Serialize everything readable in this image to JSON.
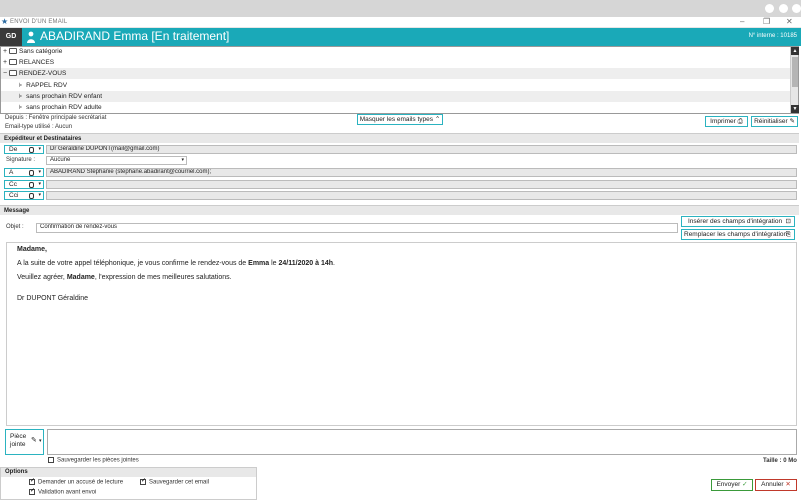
{
  "window": {
    "title": "ENVOI D'UN EMAIL"
  },
  "header": {
    "badge": "GD",
    "patient": "ABADIRAND Emma  [En traitement]",
    "internal_id": "N° interne : 10185"
  },
  "tree": {
    "items": [
      {
        "label": "Sans catégorie",
        "glyph": "+"
      },
      {
        "label": "RELANCES",
        "glyph": "+"
      },
      {
        "label": "RENDEZ-VOUS",
        "glyph": "−"
      },
      {
        "label": "RAPPEL RDV"
      },
      {
        "label": "sans prochain RDV enfant"
      },
      {
        "label": "sans prochain RDV adulte"
      }
    ]
  },
  "info": {
    "depuis": "Depuis : Fenêtre principale secrétariat",
    "email_type": "Email-type utilisé : Aucun"
  },
  "buttons": {
    "hide_types": "Masquer les emails types",
    "print": "Imprimer",
    "reset": "Réinitialiser",
    "insert_fields": "Insérer des champs d'intégration",
    "replace_fields": "Remplacer les champs d'intégration",
    "send": "Envoyer",
    "cancel": "Annuler"
  },
  "sections": {
    "sender": "Expéditeur et Destinataires",
    "message": "Message",
    "options": "Options"
  },
  "sender": {
    "from_label": "De",
    "from_value": "Dr Géraldine DUPONT(mail@gmail.com)",
    "signature_label": "Signature :",
    "signature_value": "Aucune",
    "to_label": "A",
    "to_value": "ABADIRAND Stéphanie (stephane.abadirant@courriel.com);",
    "cc_label": "Cc",
    "cci_label": "Cci"
  },
  "message": {
    "subject_label": "Objet :",
    "subject_value": "Confirmation de rendez-vous",
    "salutation": "Madame,",
    "line1_a": "A la suite de votre appel téléphonique, je vous confirme le rendez-vous de ",
    "line1_name": "Emma",
    "line1_b": " le ",
    "line1_date": "24/11/2020 à 14h",
    "line1_c": ".",
    "line2_a": "Veuillez agréer, ",
    "line2_b": "Madame",
    "line2_c": ", l'expression de mes meilleures salutations.",
    "signature": "Dr DUPONT Géraldine"
  },
  "attachments": {
    "label_1": "Pièce",
    "label_2": "jointe",
    "save_label": "Sauvegarder les pièces jointes",
    "size": "Taille : 0 Mo"
  },
  "options": {
    "read_receipt": "Demander un accusé de lecture",
    "save_email": "Sauvegarder cet email",
    "validate": "Validation avant envoi"
  },
  "colors": {
    "accent": "#1aa9b8",
    "send": "#3a9a3a",
    "cancel": "#c0392b"
  }
}
